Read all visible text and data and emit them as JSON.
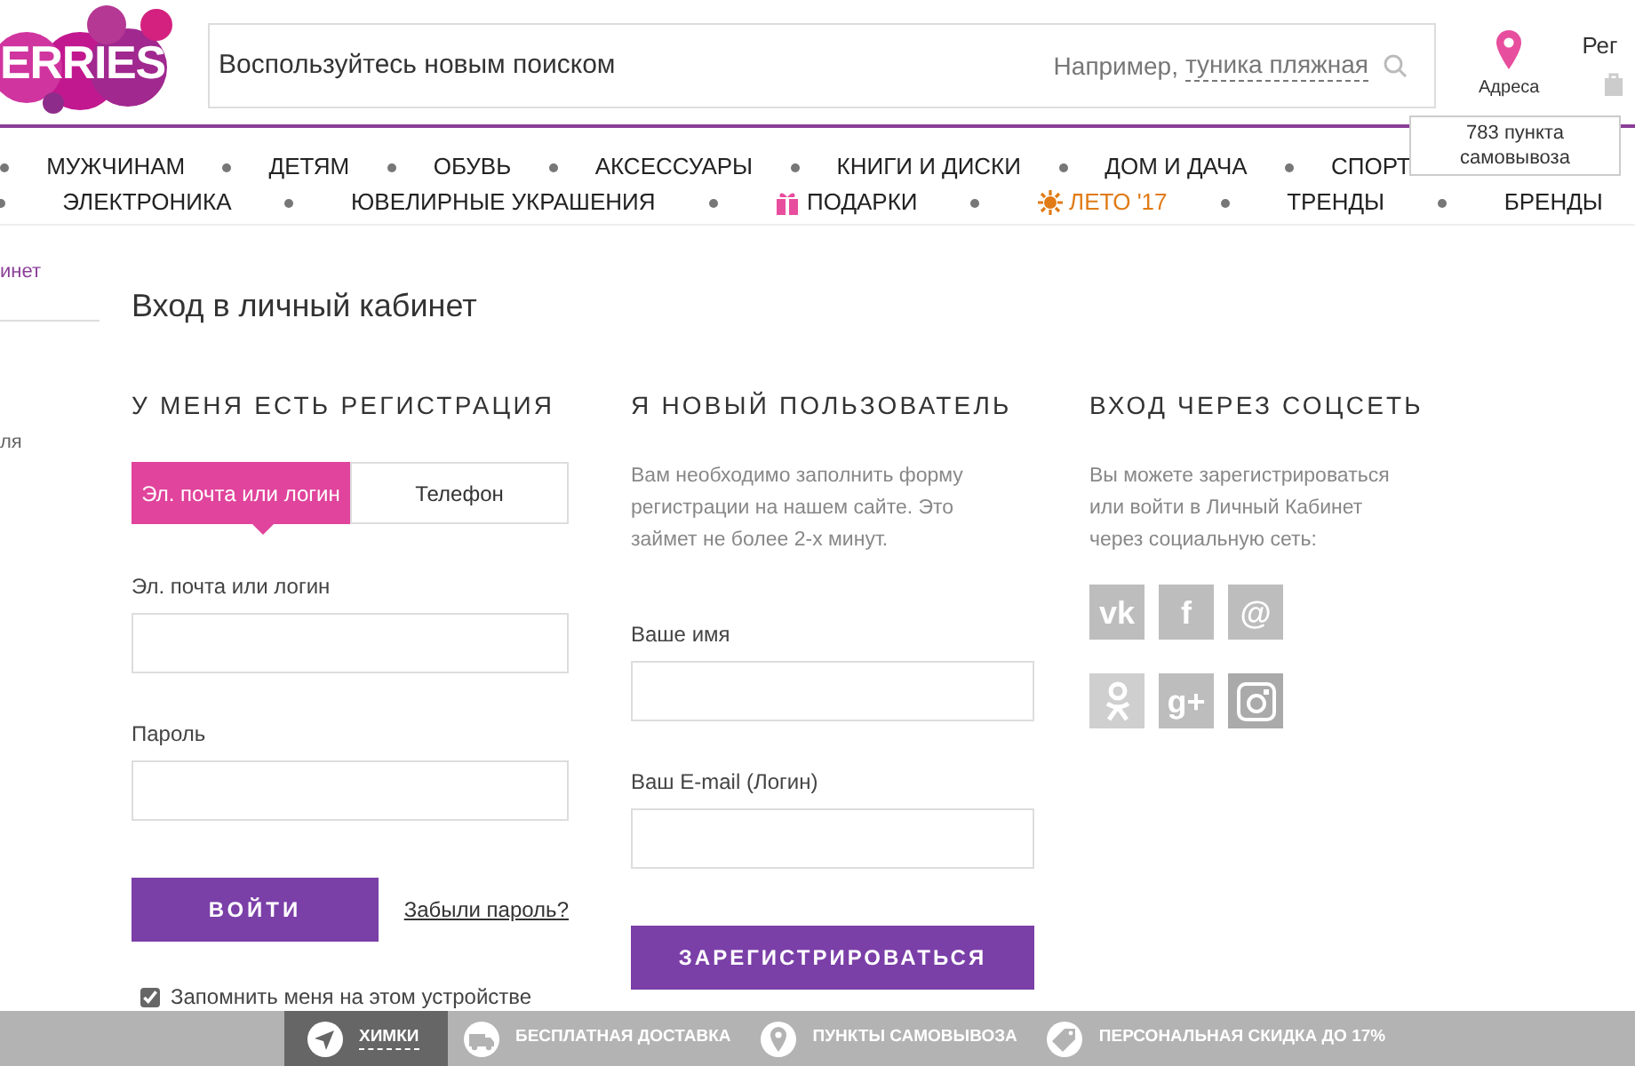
{
  "logo": {
    "text": "ERRIES"
  },
  "search": {
    "placeholder": "Воспользуйтесь новым поиском",
    "example_label": "Например,",
    "example_link": "туника пляжная"
  },
  "header": {
    "addresses": "Адреса",
    "account": "Рег",
    "tooltip": "783 пункта самовывоза"
  },
  "nav_rows": [
    [
      {
        "label": "МУЖЧИНАМ",
        "kind": "plain"
      },
      {
        "label": "ДЕТЯМ",
        "kind": "plain"
      },
      {
        "label": "ОБУВЬ",
        "kind": "plain"
      },
      {
        "label": "АКСЕССУАРЫ",
        "kind": "plain"
      },
      {
        "label": "КНИГИ И ДИСКИ",
        "kind": "plain"
      },
      {
        "label": "ДОМ И ДАЧА",
        "kind": "plain"
      },
      {
        "label": "СПОРТ",
        "kind": "plain"
      }
    ],
    [
      {
        "label": "ЭЛЕКТРОНИКА",
        "kind": "plain"
      },
      {
        "label": "ЮВЕЛИРНЫЕ УКРАШЕНИЯ",
        "kind": "plain"
      },
      {
        "label": "ПОДАРКИ",
        "kind": "gift"
      },
      {
        "label": "ЛЕТО '17",
        "kind": "summer"
      },
      {
        "label": "ТРЕНДЫ",
        "kind": "plain"
      },
      {
        "label": "БРЕНДЫ",
        "kind": "plain"
      }
    ]
  ],
  "sidebar": {
    "items": [
      {
        "label": "инет",
        "selected": true
      },
      {
        "label": "ля",
        "selected": false
      }
    ]
  },
  "page_title": "Вход в личный кабинет",
  "login": {
    "heading": "У МЕНЯ ЕСТЬ РЕГИСТРАЦИЯ",
    "tabs": [
      {
        "label": "Эл. почта или логин",
        "selected": true
      },
      {
        "label": "Телефон",
        "selected": false
      }
    ],
    "fields": [
      {
        "label": "Эл. почта или логин"
      },
      {
        "label": "Пароль"
      }
    ],
    "submit": "ВОЙТИ",
    "forgot": "Забыли пароль?",
    "remember": {
      "label": "Запомнить меня на этом устройстве",
      "checked": true
    }
  },
  "register": {
    "heading": "Я НОВЫЙ ПОЛЬЗОВАТЕЛЬ",
    "text": "Вам необходимо заполнить форму регистрации на нашем сайте. Это займет не более 2-х минут.",
    "fields": [
      {
        "label": "Ваше имя"
      },
      {
        "label": "Ваш E-mail (Логин)"
      }
    ],
    "submit": "ЗАРЕГИСТРИРОВАТЬСЯ"
  },
  "social": {
    "heading": "ВХОД ЧЕРЕЗ СОЦСЕТЬ",
    "text": "Вы можете зарегистрироваться или войти в Личный Кабинет через социальную сеть:",
    "networks": [
      {
        "kind": "glyph",
        "glyph": "vk"
      },
      {
        "kind": "glyph",
        "glyph": "f"
      },
      {
        "kind": "glyph",
        "glyph": "@"
      },
      {
        "kind": "ok"
      },
      {
        "kind": "glyph",
        "glyph": "g+"
      },
      {
        "kind": "camera"
      }
    ]
  },
  "footer": [
    {
      "kind": "city",
      "label": "ХИМКИ"
    },
    {
      "kind": "delivery",
      "label": "БЕСПЛАТНАЯ ДОСТАВКА"
    },
    {
      "kind": "pickup",
      "label": "ПУНКТЫ САМОВЫВОЗА"
    },
    {
      "kind": "discount",
      "label": "ПЕРСОНАЛЬНАЯ СКИДКА ДО 17%"
    }
  ]
}
